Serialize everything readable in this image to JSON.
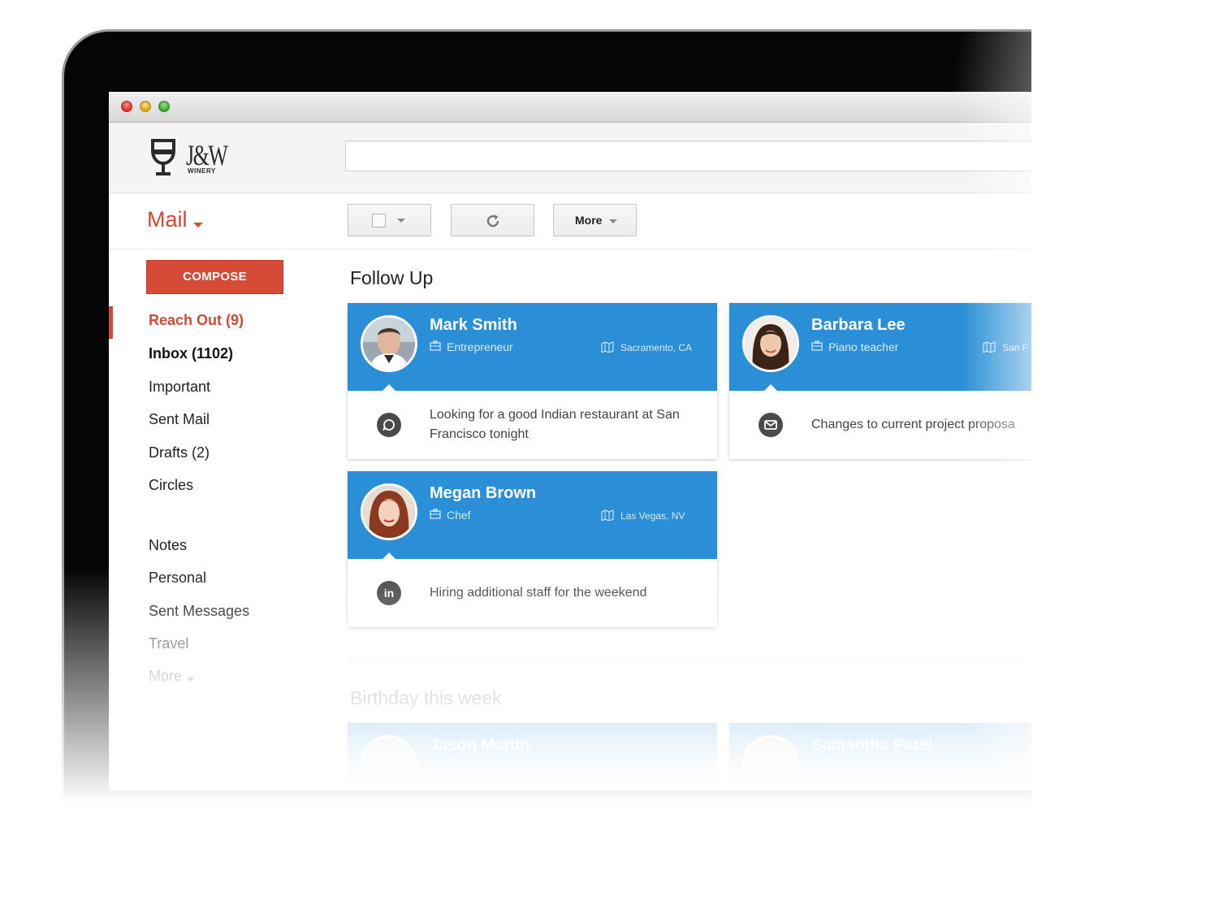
{
  "app": {
    "logo_text": "J&W",
    "logo_sub": "WINERY",
    "search_value": ""
  },
  "toolbar": {
    "mail_label": "Mail",
    "more_label": "More"
  },
  "sidebar": {
    "compose_label": "COMPOSE",
    "items": [
      {
        "label": "Reach Out (9)",
        "active": true
      },
      {
        "label": "Inbox (1102)"
      },
      {
        "label": "Important"
      },
      {
        "label": "Sent Mail"
      },
      {
        "label": "Drafts (2)"
      },
      {
        "label": "Circles"
      },
      {
        "label": "Notes"
      },
      {
        "label": "Personal"
      },
      {
        "label": "Sent Messages"
      },
      {
        "label": "Travel"
      },
      {
        "label": "More"
      }
    ]
  },
  "main": {
    "sections": [
      {
        "title": "Follow Up",
        "cards": [
          {
            "name": "Mark Smith",
            "job": "Entrepreneur",
            "location": "Sacramento, CA",
            "message": "Looking for a good Indian restaurant at San Francisco tonight",
            "message_icon": "chat-bubble-icon"
          },
          {
            "name": "Barbara Lee",
            "job": "Piano teacher",
            "location": "San F",
            "message": "Changes to current project proposa",
            "message_icon": "mail-icon"
          },
          {
            "name": "Megan Brown",
            "job": "Chef",
            "location": "Las Vegas, NV",
            "message": "Hiring additional staff for the weekend",
            "message_icon": "linkedin-icon"
          }
        ]
      },
      {
        "title": "Birthday this week",
        "cards": [
          {
            "name": "Jason Martin"
          },
          {
            "name": "Samantha Patel"
          }
        ]
      }
    ]
  },
  "colors": {
    "accent_red": "#d34836",
    "card_blue": "#2a8fd6"
  }
}
